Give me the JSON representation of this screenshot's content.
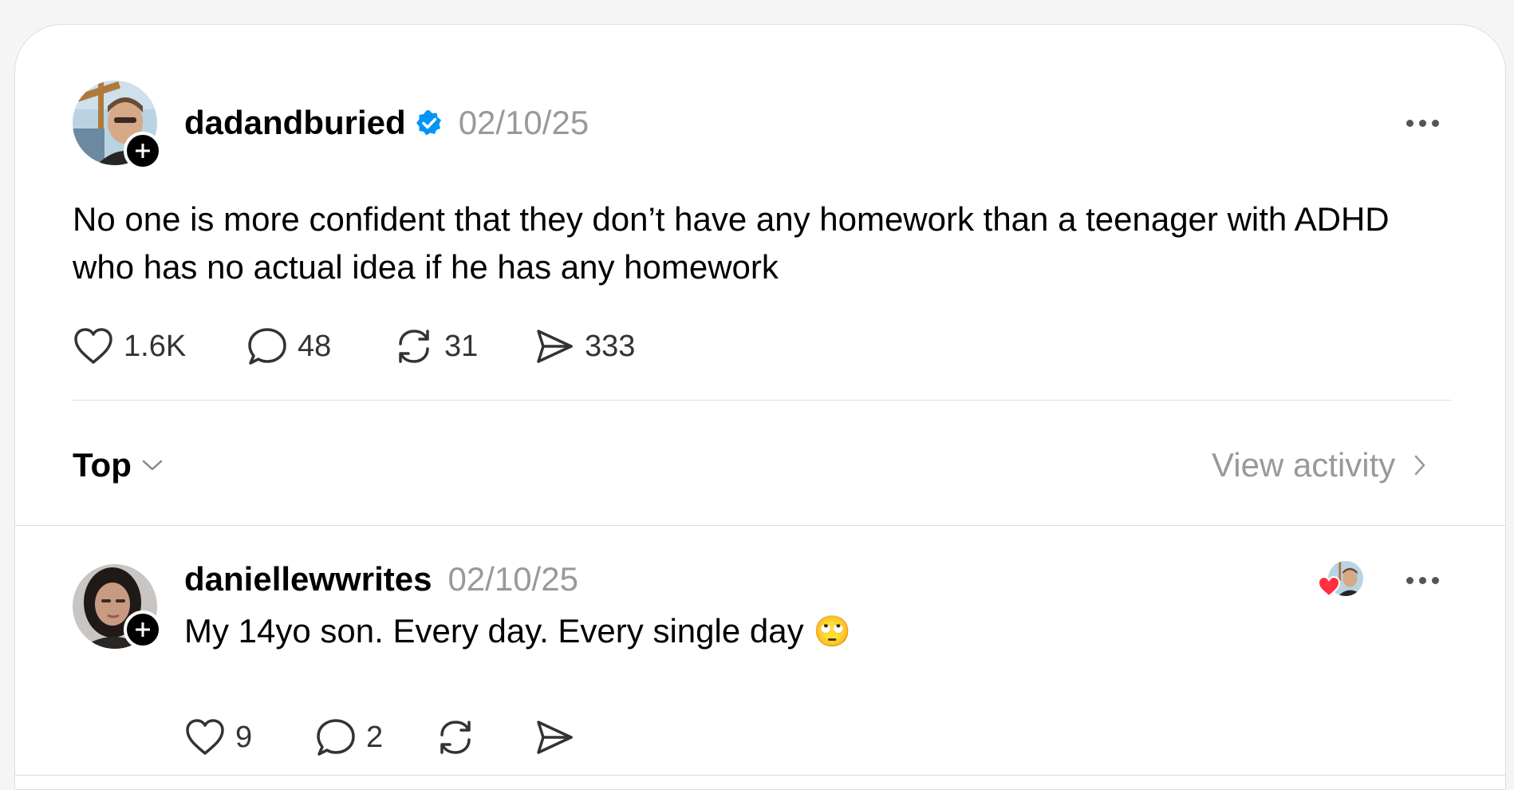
{
  "post": {
    "username": "dadandburied",
    "verified": true,
    "date": "02/10/25",
    "text": "No one is more confident that they don’t have any homework than a teenager with ADHD who has no actual idea if he has any homework",
    "actions": {
      "likes": "1.6K",
      "replies": "48",
      "reposts": "31",
      "shares": "333"
    }
  },
  "sort": {
    "label": "Top",
    "view_activity": "View activity"
  },
  "reply": {
    "username": "daniellewwrites",
    "date": "02/10/25",
    "text": "My 14yo son. Every day. Every single day",
    "emoji": "🙄",
    "author_liked": true,
    "actions": {
      "likes": "9",
      "replies": "2",
      "reposts": "",
      "shares": ""
    }
  },
  "colors": {
    "verified_badge": "#0095f6",
    "liked_heart": "#ff3040",
    "muted_text": "#999999"
  },
  "icons": {
    "follow": "plus-icon",
    "like": "heart-icon",
    "reply": "speech-bubble-icon",
    "repost": "repost-icon",
    "share": "paper-plane-icon",
    "more": "more-dots-icon",
    "sort": "chevron-down-icon",
    "view_activity": "chevron-right-icon"
  }
}
